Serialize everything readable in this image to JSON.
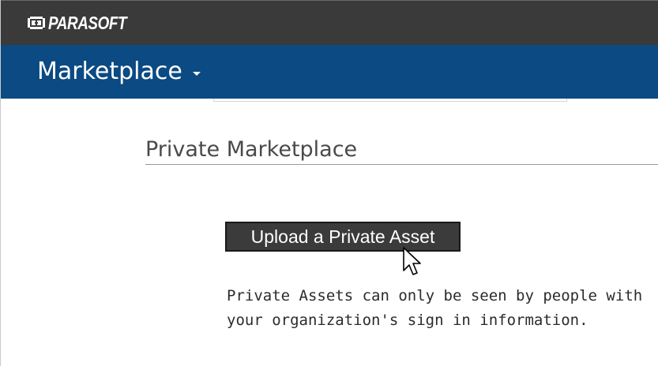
{
  "header": {
    "brand": "PARASOFT",
    "logo_icon": "parasoft-logo-icon",
    "colors": {
      "background": "#3a3a3a",
      "text": "#ffffff"
    }
  },
  "nav": {
    "menu_label": "Marketplace",
    "menu_icon": "chevron-down-icon",
    "colors": {
      "background": "#0b4a82"
    }
  },
  "main": {
    "section_title": "Private Marketplace",
    "upload_button_label": "Upload a Private Asset",
    "description_lines": [
      "Private Assets can only be seen by people with",
      "your organization's sign in information."
    ],
    "cursor_icon": "mouse-pointer-icon"
  }
}
